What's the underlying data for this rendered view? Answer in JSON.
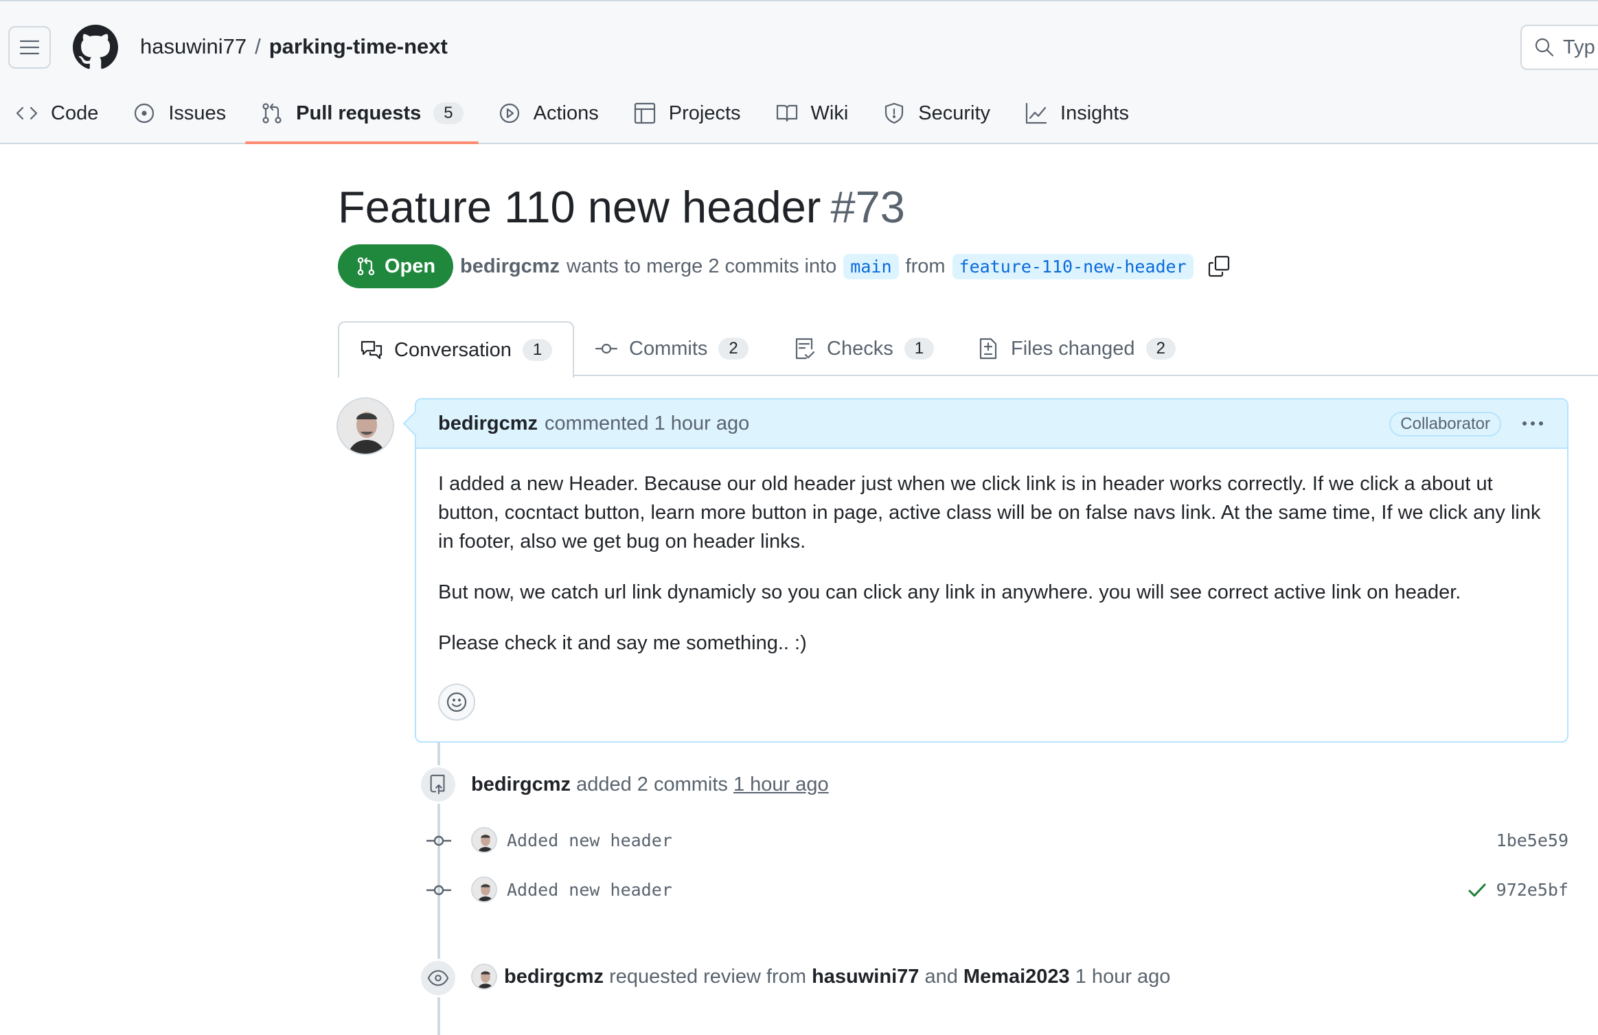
{
  "header": {
    "owner": "hasuwini77",
    "separator": "/",
    "repo": "parking-time-next",
    "search_placeholder": "Typ"
  },
  "nav": {
    "code": "Code",
    "issues": "Issues",
    "pull_requests": "Pull requests",
    "pull_requests_count": "5",
    "actions": "Actions",
    "projects": "Projects",
    "wiki": "Wiki",
    "security": "Security",
    "insights": "Insights"
  },
  "pr": {
    "title": "Feature 110 new header",
    "number": "#73",
    "state": "Open",
    "author": "bedirgcmz",
    "meta_text": "wants to merge 2 commits into",
    "base_branch": "main",
    "from_text": "from",
    "head_branch": "feature-110-new-header"
  },
  "tabs": {
    "conversation": "Conversation",
    "conversation_count": "1",
    "commits": "Commits",
    "commits_count": "2",
    "checks": "Checks",
    "checks_count": "1",
    "files": "Files changed",
    "files_count": "2"
  },
  "comment": {
    "author": "bedirgcmz",
    "action": "commented 1 hour ago",
    "badge": "Collaborator",
    "p1": "I added a new Header. Because our old header just when we click link is in header works correctly. If we click a about ut button, cocntact button, learn more button in page, active class will be on false navs link. At the same time, If we click any link in footer, also we get bug on header links.",
    "p2": "But now, we catch url link dynamicly so you can click any link in anywhere. you will see correct active link on header.",
    "p3": "Please check it and say me something.. :)"
  },
  "timeline": {
    "commits_event": {
      "author": "bedirgcmz",
      "text": "added 2 commits",
      "time": "1 hour ago"
    },
    "commits": [
      {
        "message": "Added new header",
        "sha": "1be5e59",
        "check": false
      },
      {
        "message": "Added new header",
        "sha": "972e5bf",
        "check": true
      }
    ],
    "review_event": {
      "author": "bedirgcmz",
      "text": "requested review from",
      "reviewer1": "hasuwini77",
      "and": "and",
      "reviewer2": "Memai2023",
      "time": "1 hour ago"
    }
  },
  "colors": {
    "open_green": "#1f883d",
    "active_tab_underline": "#fd8c73",
    "comment_header_bg": "#ddf4ff",
    "link_blue": "#0969da"
  }
}
